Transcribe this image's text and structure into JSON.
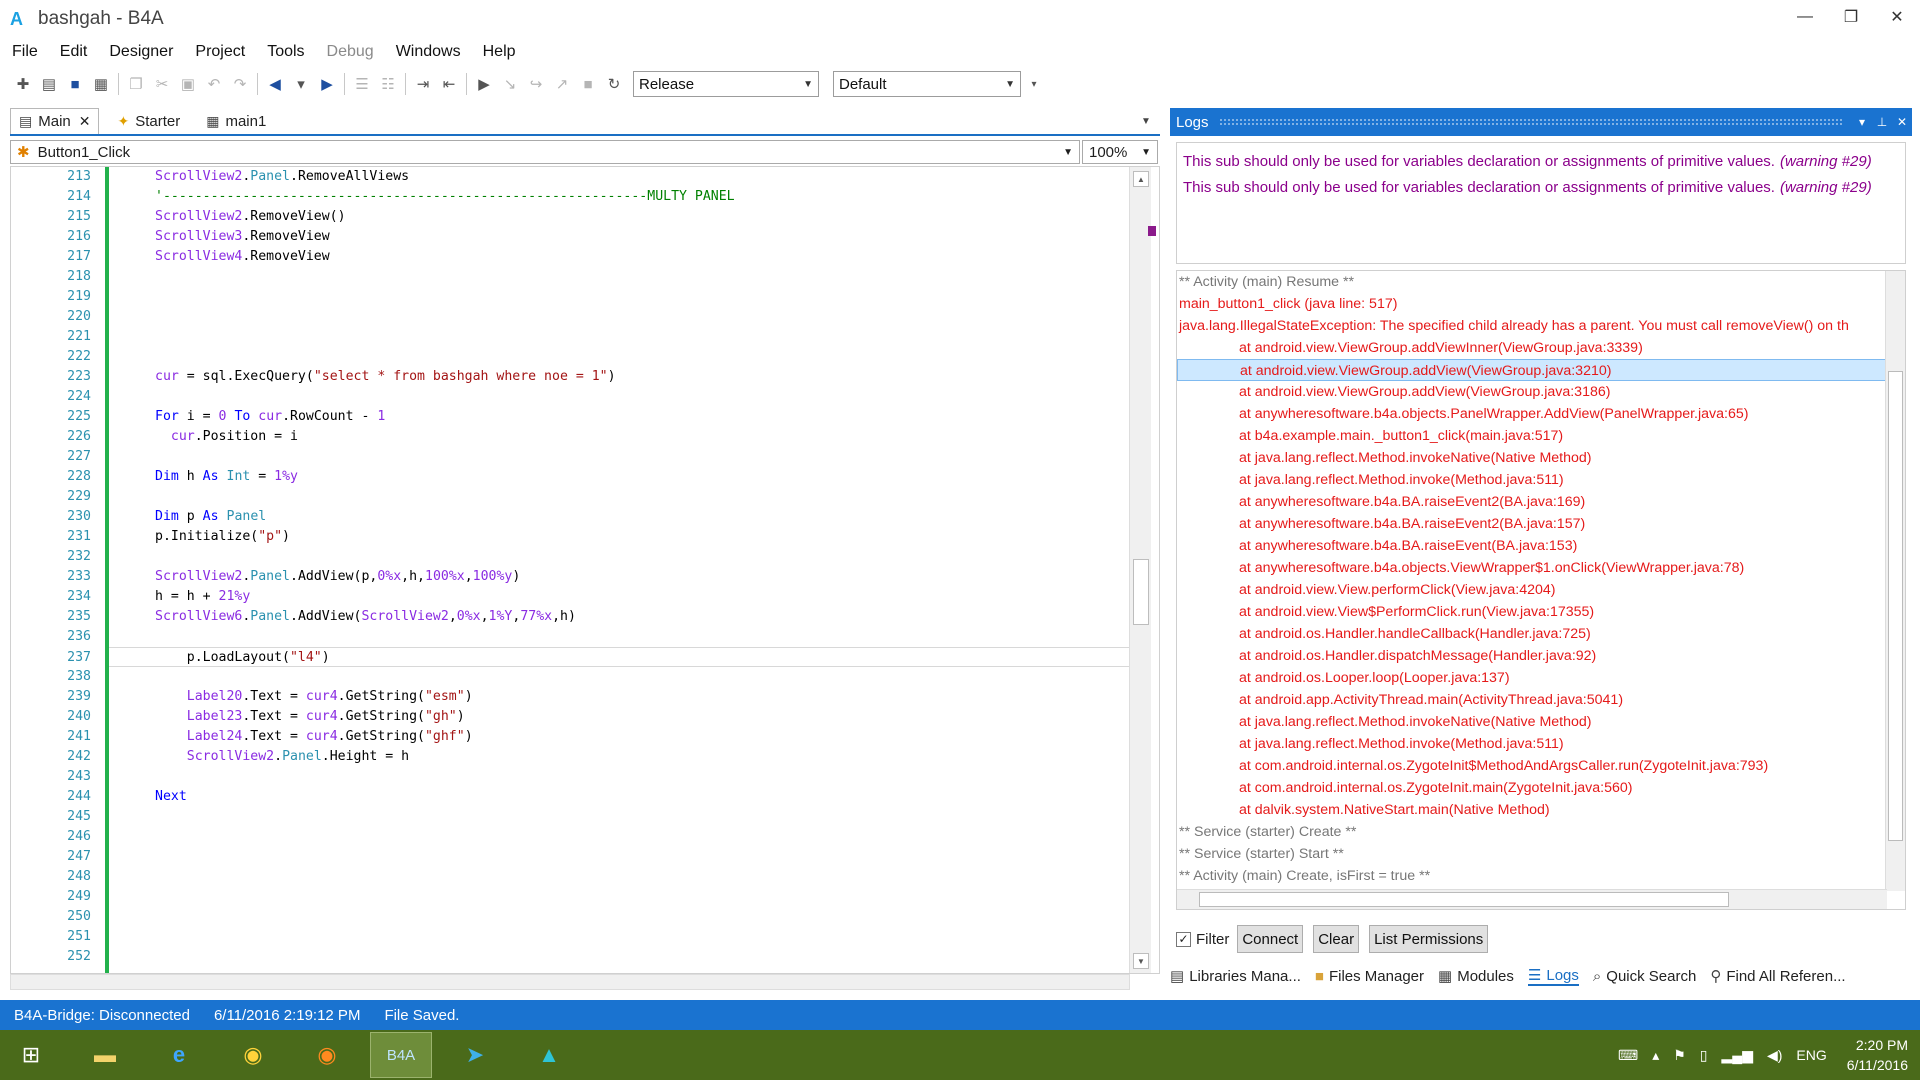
{
  "window": {
    "title": "bashgah - B4A",
    "logo": "A",
    "minimize": "—",
    "maximize": "❐",
    "close": "✕"
  },
  "menu": [
    "File",
    "Edit",
    "Designer",
    "Project",
    "Tools",
    "Debug",
    "Windows",
    "Help"
  ],
  "menu_disabled": [
    "Debug"
  ],
  "toolbar": {
    "build_config": "Release",
    "device_config": "Default"
  },
  "tabs": [
    {
      "label": "Main",
      "icon": "module-icon",
      "active": true,
      "close": "✕"
    },
    {
      "label": "Starter",
      "icon": "service-icon",
      "active": false
    },
    {
      "label": "main1",
      "icon": "layout-icon",
      "active": false
    }
  ],
  "editor": {
    "sub_selector": "Button1_Click",
    "zoom": "100%",
    "lines": [
      {
        "n": "213",
        "t": "ScrollView2.Panel.RemoveAllViews"
      },
      {
        "n": "214",
        "t": "'-------------------------------------------------------------MULTY PANEL"
      },
      {
        "n": "215",
        "t": "ScrollView2.RemoveView()"
      },
      {
        "n": "216",
        "t": "ScrollView3.RemoveView"
      },
      {
        "n": "217",
        "t": "ScrollView4.RemoveView"
      },
      {
        "n": "218",
        "t": ""
      },
      {
        "n": "219",
        "t": ""
      },
      {
        "n": "220",
        "t": ""
      },
      {
        "n": "221",
        "t": ""
      },
      {
        "n": "222",
        "t": ""
      },
      {
        "n": "223",
        "t": "cur = sql.ExecQuery(\"select * from bashgah where noe = 1\")"
      },
      {
        "n": "224",
        "t": ""
      },
      {
        "n": "225",
        "t": "For i = 0 To cur.RowCount - 1"
      },
      {
        "n": "226",
        "t": "  cur.Position = i"
      },
      {
        "n": "227",
        "t": ""
      },
      {
        "n": "228",
        "t": "Dim h As Int = 1%y"
      },
      {
        "n": "229",
        "t": ""
      },
      {
        "n": "230",
        "t": "Dim p As Panel"
      },
      {
        "n": "231",
        "t": "p.Initialize(\"p\")"
      },
      {
        "n": "232",
        "t": ""
      },
      {
        "n": "233",
        "t": "ScrollView2.Panel.AddView(p,0%x,h,100%x,100%y)"
      },
      {
        "n": "234",
        "t": "h = h + 21%y"
      },
      {
        "n": "235",
        "t": "ScrollView6.Panel.AddView(ScrollView2,0%x,1%Y,77%x,h)"
      },
      {
        "n": "236",
        "t": ""
      },
      {
        "n": "237",
        "t": "    p.LoadLayout(\"l4\")"
      },
      {
        "n": "238",
        "t": ""
      },
      {
        "n": "239",
        "t": "    Label20.Text = cur4.GetString(\"esm\")"
      },
      {
        "n": "240",
        "t": "    Label23.Text = cur4.GetString(\"gh\")"
      },
      {
        "n": "241",
        "t": "    Label24.Text = cur4.GetString(\"ghf\")"
      },
      {
        "n": "242",
        "t": "    ScrollView2.Panel.Height = h"
      },
      {
        "n": "243",
        "t": ""
      },
      {
        "n": "244",
        "t": "Next"
      },
      {
        "n": "245",
        "t": ""
      },
      {
        "n": "246",
        "t": ""
      },
      {
        "n": "247",
        "t": ""
      },
      {
        "n": "248",
        "t": ""
      },
      {
        "n": "249",
        "t": ""
      },
      {
        "n": "250",
        "t": ""
      },
      {
        "n": "251",
        "t": ""
      },
      {
        "n": "252",
        "t": ""
      }
    ]
  },
  "logs": {
    "title": "Logs",
    "warnings": [
      {
        "text": "This sub should only be used for variables declaration or assignments of primitive values.",
        "code": "(warning #29)"
      },
      {
        "text": "This sub should only be used for variables declaration or assignments of primitive values.",
        "code": "(warning #29)"
      }
    ],
    "entries": [
      {
        "text": "** Activity (main) Resume **",
        "kind": "gray",
        "indent": false
      },
      {
        "text": "main_button1_click (java line: 517)",
        "kind": "red",
        "indent": false
      },
      {
        "text": "java.lang.IllegalStateException: The specified child already has a parent. You must call removeView() on th",
        "kind": "red",
        "indent": false
      },
      {
        "text": "at android.view.ViewGroup.addViewInner(ViewGroup.java:3339)",
        "kind": "red",
        "indent": true
      },
      {
        "text": "at android.view.ViewGroup.addView(ViewGroup.java:3210)",
        "kind": "red",
        "indent": true,
        "selected": true
      },
      {
        "text": "at android.view.ViewGroup.addView(ViewGroup.java:3186)",
        "kind": "red",
        "indent": true
      },
      {
        "text": "at anywheresoftware.b4a.objects.PanelWrapper.AddView(PanelWrapper.java:65)",
        "kind": "red",
        "indent": true
      },
      {
        "text": "at b4a.example.main._button1_click(main.java:517)",
        "kind": "red",
        "indent": true
      },
      {
        "text": "at java.lang.reflect.Method.invokeNative(Native Method)",
        "kind": "red",
        "indent": true
      },
      {
        "text": "at java.lang.reflect.Method.invoke(Method.java:511)",
        "kind": "red",
        "indent": true
      },
      {
        "text": "at anywheresoftware.b4a.BA.raiseEvent2(BA.java:169)",
        "kind": "red",
        "indent": true
      },
      {
        "text": "at anywheresoftware.b4a.BA.raiseEvent2(BA.java:157)",
        "kind": "red",
        "indent": true
      },
      {
        "text": "at anywheresoftware.b4a.BA.raiseEvent(BA.java:153)",
        "kind": "red",
        "indent": true
      },
      {
        "text": "at anywheresoftware.b4a.objects.ViewWrapper$1.onClick(ViewWrapper.java:78)",
        "kind": "red",
        "indent": true
      },
      {
        "text": "at android.view.View.performClick(View.java:4204)",
        "kind": "red",
        "indent": true
      },
      {
        "text": "at android.view.View$PerformClick.run(View.java:17355)",
        "kind": "red",
        "indent": true
      },
      {
        "text": "at android.os.Handler.handleCallback(Handler.java:725)",
        "kind": "red",
        "indent": true
      },
      {
        "text": "at android.os.Handler.dispatchMessage(Handler.java:92)",
        "kind": "red",
        "indent": true
      },
      {
        "text": "at android.os.Looper.loop(Looper.java:137)",
        "kind": "red",
        "indent": true
      },
      {
        "text": "at android.app.ActivityThread.main(ActivityThread.java:5041)",
        "kind": "red",
        "indent": true
      },
      {
        "text": "at java.lang.reflect.Method.invokeNative(Native Method)",
        "kind": "red",
        "indent": true
      },
      {
        "text": "at java.lang.reflect.Method.invoke(Method.java:511)",
        "kind": "red",
        "indent": true
      },
      {
        "text": "at com.android.internal.os.ZygoteInit$MethodAndArgsCaller.run(ZygoteInit.java:793)",
        "kind": "red",
        "indent": true
      },
      {
        "text": "at com.android.internal.os.ZygoteInit.main(ZygoteInit.java:560)",
        "kind": "red",
        "indent": true
      },
      {
        "text": "at dalvik.system.NativeStart.main(Native Method)",
        "kind": "red",
        "indent": true
      },
      {
        "text": "** Service (starter) Create **",
        "kind": "gray",
        "indent": false
      },
      {
        "text": "** Service (starter) Start **",
        "kind": "gray",
        "indent": false
      },
      {
        "text": "** Activity (main) Create, isFirst = true **",
        "kind": "gray",
        "indent": false
      }
    ],
    "filter_label": "Filter",
    "filter_checked": true,
    "connect_label": "Connect",
    "clear_label": "Clear",
    "permissions_label": "List Permissions"
  },
  "bottom_tabs": [
    {
      "label": "Libraries Mana...",
      "icon": "libraries-icon"
    },
    {
      "label": "Files Manager",
      "icon": "folder-icon"
    },
    {
      "label": "Modules",
      "icon": "modules-icon"
    },
    {
      "label": "Logs",
      "icon": "logs-icon",
      "active": true
    },
    {
      "label": "Quick Search",
      "icon": "search-icon"
    },
    {
      "label": "Find All Referen...",
      "icon": "find-references-icon"
    }
  ],
  "status": {
    "bridge": "B4A-Bridge: Disconnected",
    "timestamp": "6/11/2016 2:19:12 PM",
    "message": "File Saved."
  },
  "taskbar": {
    "b4a_label": "B4A",
    "language": "ENG",
    "time": "2:20 PM",
    "date": "6/11/2016"
  },
  "colors": {
    "accent": "#1a73d0",
    "error": "#e51a1a",
    "warning": "#8b008b",
    "gutter": "#22b14c"
  }
}
